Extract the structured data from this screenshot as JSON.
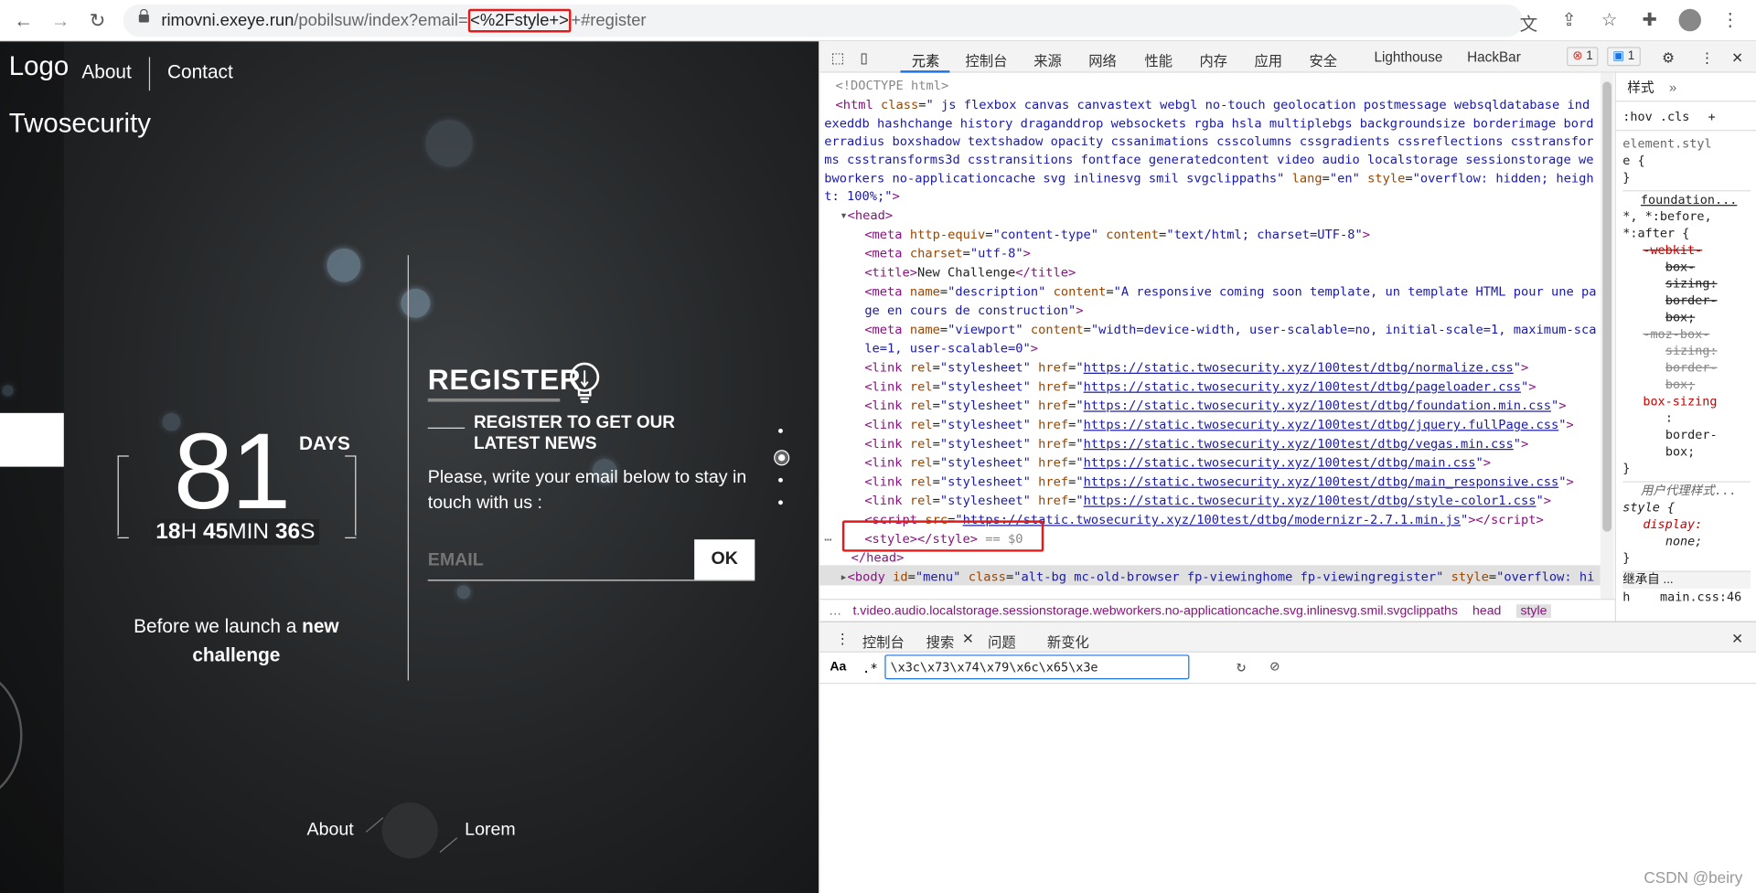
{
  "browser": {
    "url_host": "rimovni.exeye.run",
    "url_path": "/pobilsuw/index?email=",
    "url_highlight": "<%2Fstyle+>",
    "url_rest": "+#register",
    "back_icon": "arrow-left-icon",
    "forward_icon": "arrow-right-icon",
    "reload_icon": "reload-icon"
  },
  "site": {
    "logo_alt": "Logo",
    "brand": "Twosecurity",
    "nav": [
      "About",
      "Contact"
    ],
    "countdown": {
      "days": "81",
      "days_label": "DAYS",
      "hours": "18",
      "h": "H",
      "minutes": "45",
      "min": "MIN",
      "seconds": "36",
      "s": "S"
    },
    "tagline_pre": "Before we launch a ",
    "tagline_bold1": "new",
    "tagline_bold2": "challenge",
    "register_title": "REGISTER",
    "register_sub": "REGISTER TO GET OUR LATEST NEWS",
    "register_desc": "Please, write your email below to stay in touch with us :",
    "email_placeholder": "EMAIL",
    "ok_label": "OK",
    "footer_nav": [
      "About",
      "Lorem"
    ]
  },
  "devtools": {
    "tabs": [
      "元素",
      "控制台",
      "来源",
      "网络",
      "性能",
      "内存",
      "应用",
      "安全",
      "Lighthouse",
      "HackBar"
    ],
    "error_count": "1",
    "message_count": "1",
    "styles_tab": "样式",
    "hov": ":hov",
    "cls": ".cls",
    "styles_lines": [
      "element.styl",
      "e {",
      "}",
      "foundation...",
      "*, *:before,",
      "*:after {",
      "-webkit-",
      "box-",
      "sizing:",
      "border-",
      "box;",
      "-moz-box-",
      "sizing:",
      "border-",
      "box;",
      "box-sizing",
      ":",
      "border-",
      "box;",
      "}",
      "用户代理样式...",
      "style {",
      "display:",
      "none;",
      "}",
      "继承自 ...",
      "h",
      "main.css:46"
    ],
    "breadcrumb_text": "t.video.audio.localstorage.sessionstorage.webworkers.no-applicationcache.svg.inlinesvg.smil.svgclippaths",
    "breadcrumb_head": "head",
    "breadcrumb_style": "style",
    "drawer_tabs": [
      "控制台",
      "搜索",
      "问题",
      "新变化"
    ],
    "search_aa": "Aa",
    "search_regex": ".*",
    "search_value": "\\x3c\\x73\\x74\\x79\\x6c\\x65\\x3e"
  },
  "watermark": "CSDN @beiry",
  "colors": {
    "highlight_red": "#e31a1a",
    "tag": "#881280",
    "attr": "#994500",
    "value": "#1a1aa6"
  }
}
